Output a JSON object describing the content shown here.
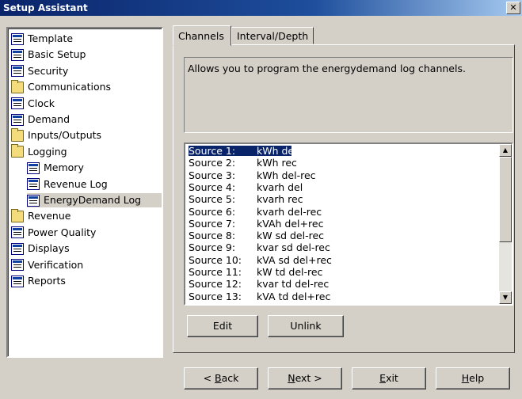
{
  "window": {
    "title": "Setup Assistant",
    "close_label": "✕"
  },
  "tree": {
    "items": [
      {
        "label": "Template",
        "icon": "doc"
      },
      {
        "label": "Basic Setup",
        "icon": "doc"
      },
      {
        "label": "Security",
        "icon": "doc"
      },
      {
        "label": "Communications",
        "icon": "folder"
      },
      {
        "label": "Clock",
        "icon": "doc"
      },
      {
        "label": "Demand",
        "icon": "doc"
      },
      {
        "label": "Inputs/Outputs",
        "icon": "folder"
      },
      {
        "label": "Logging",
        "icon": "folder"
      },
      {
        "label": "Memory",
        "icon": "doc"
      },
      {
        "label": "Revenue Log",
        "icon": "doc"
      },
      {
        "label": "EnergyDemand Log",
        "icon": "doc"
      },
      {
        "label": "Revenue",
        "icon": "folder"
      },
      {
        "label": "Power Quality",
        "icon": "doc"
      },
      {
        "label": "Displays",
        "icon": "doc"
      },
      {
        "label": "Verification",
        "icon": "doc"
      },
      {
        "label": "Reports",
        "icon": "doc"
      }
    ]
  },
  "tabs": [
    {
      "label": "Channels",
      "active": true
    },
    {
      "label": "Interval/Depth",
      "active": false
    }
  ],
  "description": "Allows you to program the energydemand log channels.",
  "sources": [
    {
      "source": "Source 1:",
      "value": "kWh del"
    },
    {
      "source": "Source 2:",
      "value": "kWh rec"
    },
    {
      "source": "Source 3:",
      "value": "kWh del-rec"
    },
    {
      "source": "Source 4:",
      "value": "kvarh del"
    },
    {
      "source": "Source 5:",
      "value": "kvarh rec"
    },
    {
      "source": "Source 6:",
      "value": "kvarh del-rec"
    },
    {
      "source": "Source 7:",
      "value": "kVAh del+rec"
    },
    {
      "source": "Source 8:",
      "value": "kW sd del-rec"
    },
    {
      "source": "Source 9:",
      "value": "kvar sd del-rec"
    },
    {
      "source": "Source 10:",
      "value": "kVA sd del+rec"
    },
    {
      "source": "Source 11:",
      "value": "kW td del-rec"
    },
    {
      "source": "Source 12:",
      "value": "kvar td del-rec"
    },
    {
      "source": "Source 13:",
      "value": "kVA td del+rec"
    }
  ],
  "actions": {
    "edit": "Edit",
    "unlink": "Unlink"
  },
  "footer": {
    "back": {
      "pre": "< ",
      "key": "B",
      "post": "ack"
    },
    "next": {
      "pre": "",
      "key": "N",
      "post": "ext >"
    },
    "exit": {
      "pre": "",
      "key": "E",
      "post": "xit"
    },
    "help": {
      "pre": "",
      "key": "H",
      "post": "elp"
    }
  }
}
